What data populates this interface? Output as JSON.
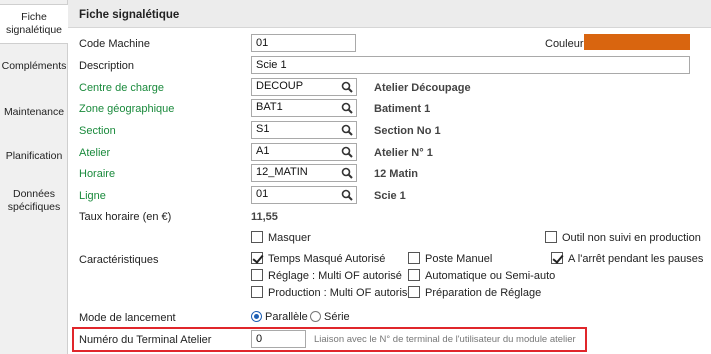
{
  "sidebar": {
    "items": [
      {
        "label_line1": "Fiche",
        "label_line2": "signalétique"
      },
      {
        "label_line1": "Compléments",
        "label_line2": ""
      },
      {
        "label_line1": "Maintenance",
        "label_line2": ""
      },
      {
        "label_line1": "Planification",
        "label_line2": ""
      },
      {
        "label_line1": "Données",
        "label_line2": "spécifiques"
      }
    ]
  },
  "header": {
    "title": "Fiche signalétique"
  },
  "fields": {
    "code_machine": {
      "label": "Code Machine",
      "value": "01"
    },
    "description": {
      "label": "Description",
      "value": "Scie 1"
    },
    "couleur": {
      "label": "Couleur",
      "color": "#d9650f"
    },
    "centre_charge": {
      "label": "Centre de charge",
      "value": "DECOUP",
      "desc": "Atelier Découpage"
    },
    "zone": {
      "label": "Zone géographique",
      "value": "BAT1",
      "desc": "Batiment 1"
    },
    "section": {
      "label": "Section",
      "value": "S1",
      "desc": "Section No 1"
    },
    "atelier": {
      "label": "Atelier",
      "value": "A1",
      "desc": "Atelier N° 1"
    },
    "horaire": {
      "label": "Horaire",
      "value": "12_MATIN",
      "desc": "12 Matin"
    },
    "ligne": {
      "label": "Ligne",
      "value": "01",
      "desc": "Scie 1"
    },
    "taux": {
      "label": "Taux horaire (en €)",
      "value": "11,55"
    }
  },
  "checkboxes": {
    "masquer": {
      "label": "Masquer",
      "checked": false
    },
    "outil_non_suivi": {
      "label": "Outil non suivi en production",
      "checked": false
    },
    "caracteristiques_label": "Caractéristiques",
    "temps_masque": {
      "label": "Temps Masqué Autorisé",
      "checked": true
    },
    "poste_manuel": {
      "label": "Poste Manuel",
      "checked": false
    },
    "arret_pauses": {
      "label": "A l'arrêt pendant les pauses",
      "checked": true
    },
    "reglage_multi": {
      "label": "Réglage : Multi OF autorisé",
      "checked": false
    },
    "auto_semi": {
      "label": "Automatique ou Semi-auto",
      "checked": false
    },
    "production_multi": {
      "label": "Production : Multi OF autorisé",
      "checked": false
    },
    "preparation": {
      "label": "Préparation de Réglage",
      "checked": false
    }
  },
  "mode": {
    "label": "Mode de lancement",
    "options": [
      "Parallèle",
      "Série"
    ],
    "selected": "Parallèle"
  },
  "terminal": {
    "label": "Numéro du Terminal Atelier",
    "value": "0",
    "hint": "Liaison avec le N° de terminal de l'utilisateur du module atelier"
  },
  "icons": {
    "lookup": "magnifier-icon"
  }
}
